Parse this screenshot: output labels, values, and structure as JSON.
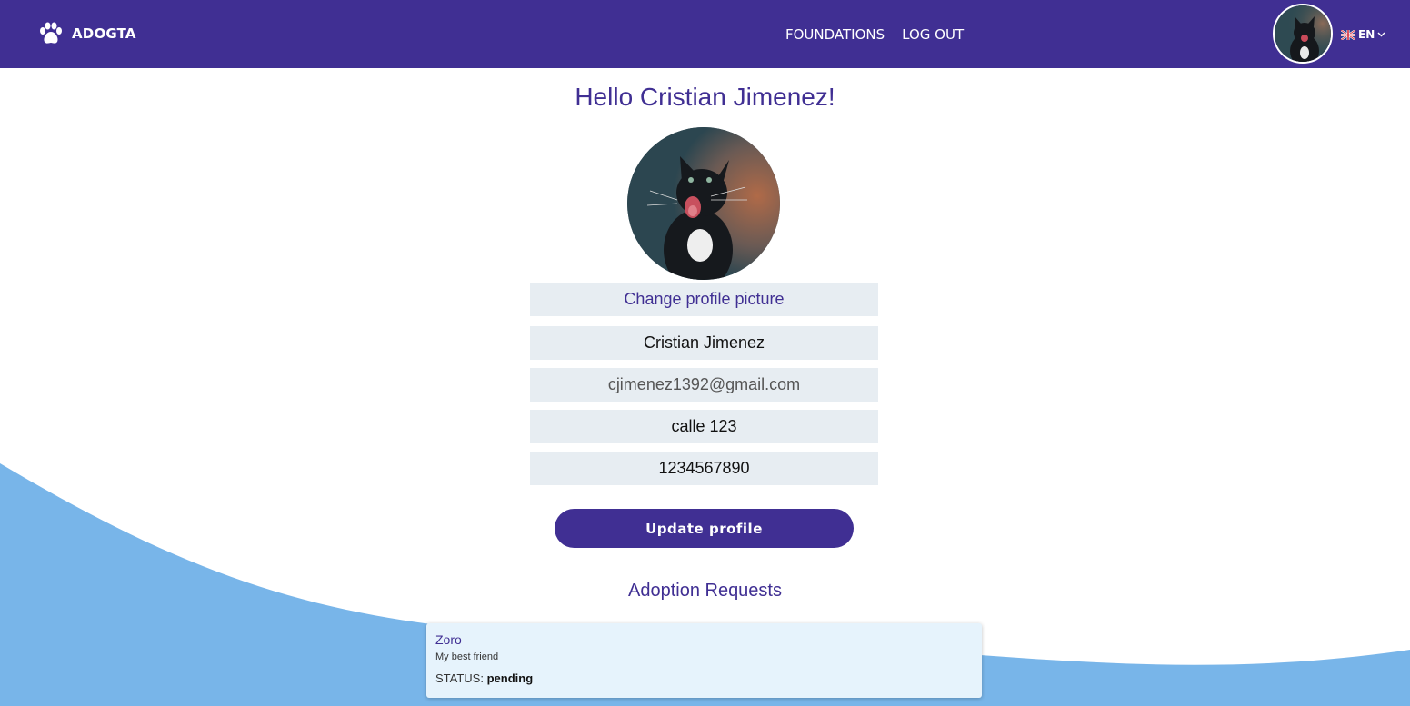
{
  "header": {
    "brand": "ADOGTA",
    "nav": [
      {
        "label": "FOUNDATIONS"
      },
      {
        "label": "LOG OUT"
      }
    ],
    "language": "EN"
  },
  "profile": {
    "greeting": "Hello Cristian Jimenez!",
    "change_picture": "Change profile picture",
    "name": "Cristian Jimenez",
    "email": "cjimenez1392@gmail.com",
    "address": "calle 123",
    "phone": "1234567890",
    "update_label": "Update profile"
  },
  "adoption_requests": {
    "title": "Adoption Requests",
    "items": [
      {
        "pet_name": "Zoro",
        "description": "My best friend",
        "status_label": "STATUS:",
        "status": "pending"
      }
    ]
  },
  "colors": {
    "primary": "#402f93",
    "wave": "#78b5e9",
    "field_bg": "#e7edf2",
    "card_bg": "#e6f3fc"
  }
}
